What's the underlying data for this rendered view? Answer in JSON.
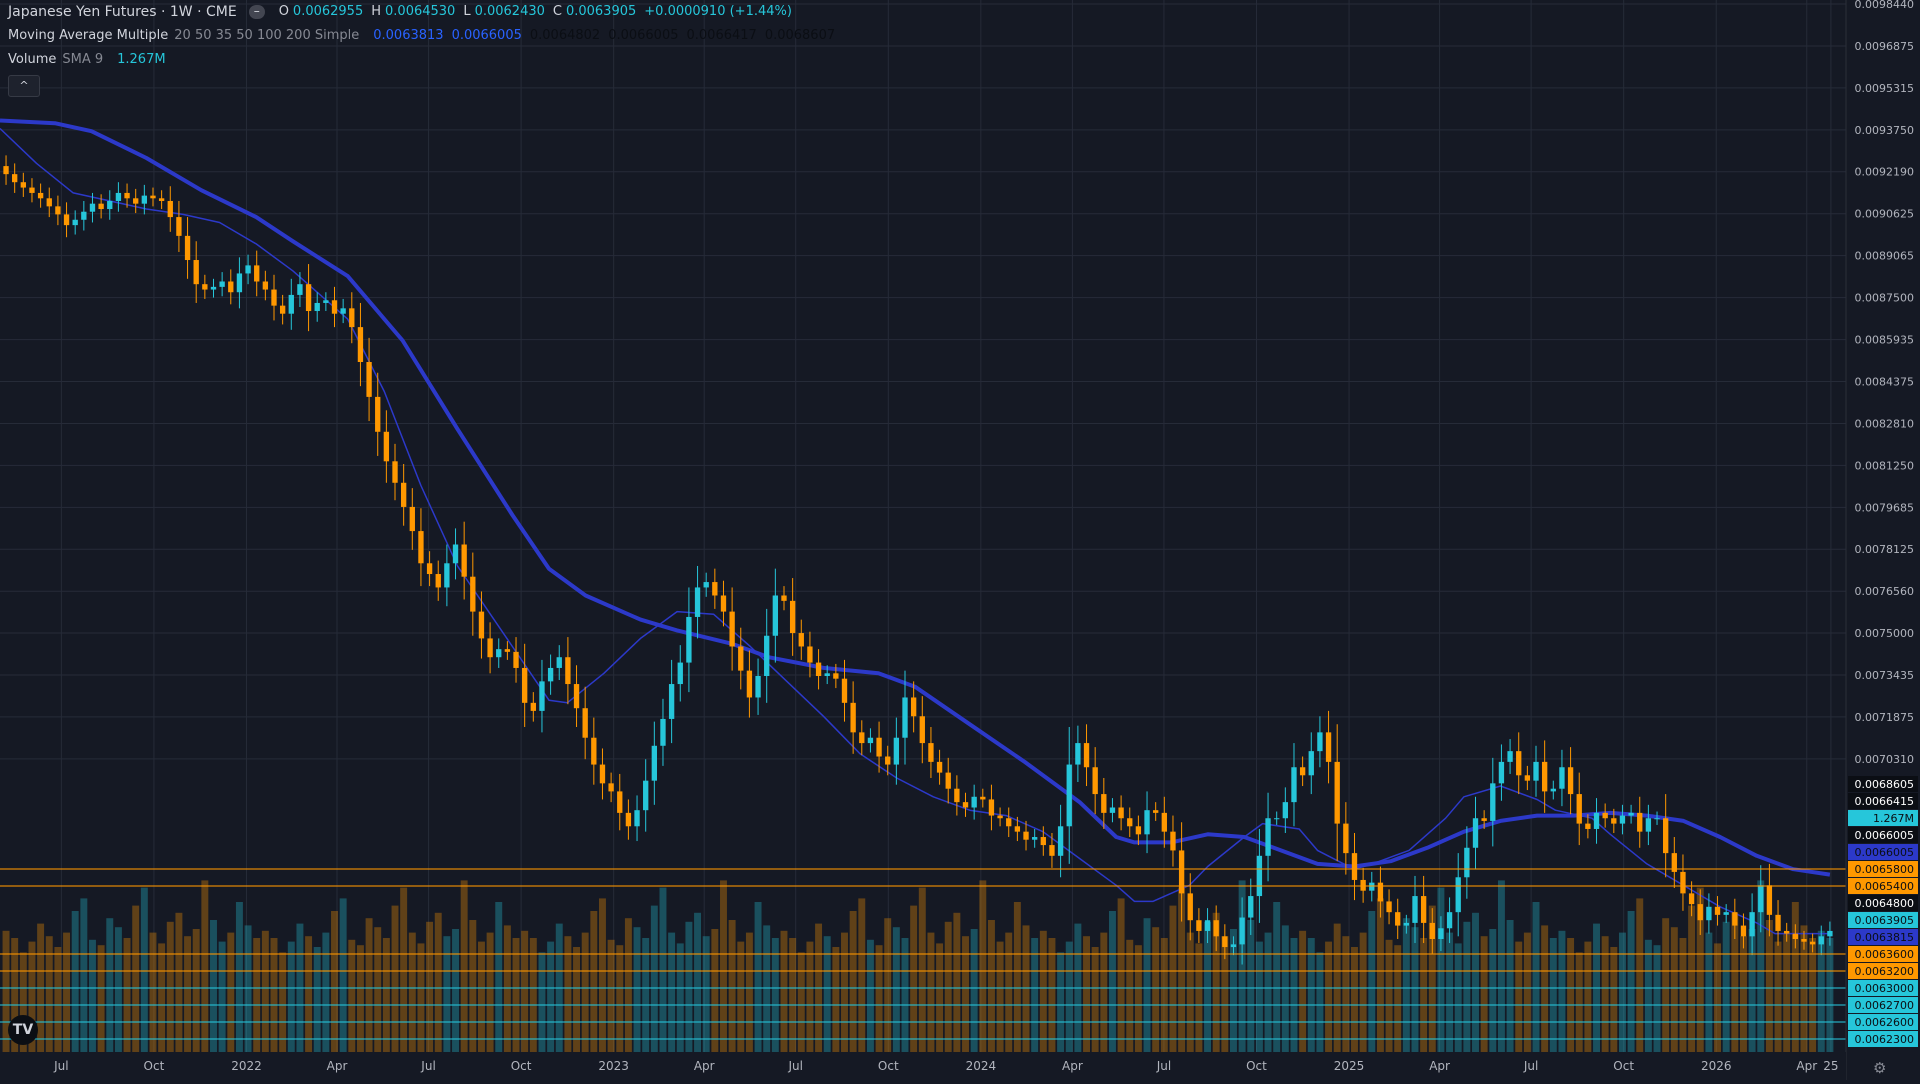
{
  "legend": {
    "symbol": "Japanese Yen Futures · 1W · CME",
    "o_label": "O",
    "o": "0.0062955",
    "h_label": "H",
    "h": "0.0064530",
    "l_label": "L",
    "l": "0.0062430",
    "c_label": "C",
    "c": "0.0063905",
    "change": "+0.0000910 (+1.44%)",
    "ma_name": "Moving Average Multiple",
    "ma_params": "20 50 35 50 100 200 Simple",
    "ma_values": [
      "0.0063813",
      "0.0066005",
      "0.0064802",
      "0.0066005",
      "0.0066417",
      "0.0068607"
    ],
    "ma_value_colors": [
      "#2962ff",
      "#2962ff",
      "#0b0e14",
      "#0b0e14",
      "#0b0e14",
      "#0b0e14"
    ],
    "vol_name": "Volume",
    "vol_params": "SMA 9",
    "vol_value": "1.267M",
    "collapse_icon": "^",
    "logo": "TV"
  },
  "chart_data": {
    "type": "candlestick",
    "instrument": "Japanese Yen Futures",
    "interval": "1W",
    "exchange": "CME",
    "colors": {
      "up": "#26c6da",
      "down": "#ff9800",
      "ma_fast": "#2c39c9",
      "ma_slow": "#2c39c9",
      "background": "#151924",
      "grid": "#262b38"
    },
    "ylim": [
      0.00623,
      0.009844
    ],
    "y_ticks": [
      "0.0098440",
      "0.0096875",
      "0.0095315",
      "0.0093750",
      "0.0092190",
      "0.0090625",
      "0.0089065",
      "0.0087500",
      "0.0085935",
      "0.0084375",
      "0.0082810",
      "0.0081250",
      "0.0079685",
      "0.0078125",
      "0.0076560",
      "0.0075000",
      "0.0073435",
      "0.0071875",
      "0.0070310"
    ],
    "x_ticks": [
      {
        "label": "Jul",
        "date": "2021-07-01"
      },
      {
        "label": "Oct",
        "date": "2021-10-01"
      },
      {
        "label": "2022",
        "date": "2022-01-01"
      },
      {
        "label": "Apr",
        "date": "2022-04-01"
      },
      {
        "label": "Jul",
        "date": "2022-07-01"
      },
      {
        "label": "Oct",
        "date": "2022-10-01"
      },
      {
        "label": "2023",
        "date": "2023-01-01"
      },
      {
        "label": "Apr",
        "date": "2023-04-01"
      },
      {
        "label": "Jul",
        "date": "2023-07-01"
      },
      {
        "label": "Oct",
        "date": "2023-10-01"
      },
      {
        "label": "2024",
        "date": "2024-01-01"
      },
      {
        "label": "Apr",
        "date": "2024-04-01"
      },
      {
        "label": "Jul",
        "date": "2024-07-01"
      },
      {
        "label": "Oct",
        "date": "2024-10-01"
      },
      {
        "label": "2025",
        "date": "2025-01-01"
      },
      {
        "label": "Apr",
        "date": "2025-04-01"
      },
      {
        "label": "Jul",
        "date": "2025-07-01"
      },
      {
        "label": "Oct",
        "date": "2025-10-01"
      },
      {
        "label": "2026",
        "date": "2026-01-01"
      },
      {
        "label": "Apr",
        "date": "2026-04-01"
      },
      {
        "label": "25",
        "date": "2026-04-25"
      }
    ],
    "price_levels": [
      {
        "label": "0.0068605",
        "bg": "#0b0e14",
        "line": false
      },
      {
        "label": "0.0066415",
        "bg": "#0b0e14",
        "line": false
      },
      {
        "label": "1.267M",
        "bg": "#26c6da",
        "line": false
      },
      {
        "label": "0.0066005",
        "bg": "#0b0e14",
        "line": false
      },
      {
        "label": "0.0066005",
        "bg": "#2c39c9",
        "line": false
      },
      {
        "label": "0.0065800",
        "bg": "#ff9800",
        "line": true
      },
      {
        "label": "0.0065400",
        "bg": "#ff9800",
        "line": true
      },
      {
        "label": "0.0064800",
        "bg": "#0b0e14",
        "line": false
      },
      {
        "label": "0.0063905",
        "bg": "#26c6da",
        "line": false
      },
      {
        "label": "0.0063815",
        "bg": "#2c39c9",
        "line": false
      },
      {
        "label": "0.0063600",
        "bg": "#ff9800",
        "line": true
      },
      {
        "label": "0.0063200",
        "bg": "#ff9800",
        "line": true
      },
      {
        "label": "0.0063000",
        "bg": "#26c6da",
        "line": true
      },
      {
        "label": "0.0062700",
        "bg": "#26c6da",
        "line": true
      },
      {
        "label": "0.0062600",
        "bg": "#26c6da",
        "line": true
      },
      {
        "label": "0.0062300",
        "bg": "#26c6da",
        "line": true
      }
    ],
    "close_series": {
      "x_start": "2021-05-07",
      "x_end": "2026-04-24",
      "closes": [
        0.00921,
        0.00918,
        0.00916,
        0.00914,
        0.00912,
        0.00909,
        0.00906,
        0.00902,
        0.00904,
        0.00907,
        0.0091,
        0.00908,
        0.00911,
        0.00914,
        0.00912,
        0.0091,
        0.00913,
        0.00912,
        0.00911,
        0.00905,
        0.00898,
        0.00889,
        0.0088,
        0.00878,
        0.00879,
        0.00881,
        0.00877,
        0.00884,
        0.00887,
        0.00881,
        0.00878,
        0.00872,
        0.00869,
        0.00876,
        0.0088,
        0.0087,
        0.00873,
        0.00874,
        0.00869,
        0.00871,
        0.00864,
        0.00851,
        0.00838,
        0.00825,
        0.00814,
        0.00806,
        0.00797,
        0.00788,
        0.00776,
        0.00772,
        0.00767,
        0.00776,
        0.00783,
        0.00771,
        0.00758,
        0.00748,
        0.00741,
        0.00744,
        0.00743,
        0.00737,
        0.00724,
        0.00721,
        0.00732,
        0.00737,
        0.00741,
        0.00731,
        0.00722,
        0.00711,
        0.00701,
        0.00694,
        0.00691,
        0.00683,
        0.00678,
        0.00684,
        0.00695,
        0.00708,
        0.00718,
        0.00731,
        0.00739,
        0.00756,
        0.00767,
        0.00769,
        0.00764,
        0.00758,
        0.00745,
        0.00736,
        0.00726,
        0.00734,
        0.00749,
        0.00764,
        0.00762,
        0.0075,
        0.00745,
        0.00739,
        0.00734,
        0.00735,
        0.00733,
        0.00724,
        0.00713,
        0.00709,
        0.00711,
        0.00704,
        0.00701,
        0.00711,
        0.00726,
        0.00719,
        0.00709,
        0.00702,
        0.00698,
        0.00692,
        0.00687,
        0.00685,
        0.00689,
        0.00688,
        0.00682,
        0.00681,
        0.00678,
        0.00676,
        0.00673,
        0.00674,
        0.00671,
        0.00667,
        0.00678,
        0.00701,
        0.00709,
        0.007,
        0.0069,
        0.00683,
        0.00685,
        0.00681,
        0.00678,
        0.00675,
        0.00684,
        0.00683,
        0.00676,
        0.00669,
        0.00653,
        0.00643,
        0.00639,
        0.00643,
        0.00637,
        0.00633,
        0.00634,
        0.00644,
        0.00652,
        0.00667,
        0.00681,
        0.00681,
        0.00687,
        0.007,
        0.00697,
        0.00706,
        0.00713,
        0.00702,
        0.00679,
        0.00668,
        0.00658,
        0.00654,
        0.00657,
        0.0065,
        0.00646,
        0.00641,
        0.00642,
        0.00652,
        0.00642,
        0.00636,
        0.0064,
        0.00646,
        0.00659,
        0.0067,
        0.00681,
        0.0068,
        0.00694,
        0.00702,
        0.00706,
        0.00697,
        0.00695,
        0.00702,
        0.00691,
        0.00692,
        0.007,
        0.0069,
        0.00679,
        0.00677,
        0.00683,
        0.00681,
        0.00679,
        0.00682,
        0.00683,
        0.00676,
        0.00681,
        0.00681,
        0.00668,
        0.00661,
        0.00653,
        0.00649,
        0.00643,
        0.00648,
        0.00645,
        0.00646,
        0.00641,
        0.00637,
        0.00646,
        0.00656,
        0.00645,
        0.00639,
        0.00638,
        0.00636,
        0.00635,
        0.00634,
        0.00637,
        0.00639
      ]
    },
    "ma_fast": [
      [
        0.0,
        0.00938
      ],
      [
        0.02,
        0.00925
      ],
      [
        0.04,
        0.00914
      ],
      [
        0.08,
        0.00908
      ],
      [
        0.1,
        0.00906
      ],
      [
        0.12,
        0.00903
      ],
      [
        0.14,
        0.00895
      ],
      [
        0.16,
        0.00885
      ],
      [
        0.19,
        0.00867
      ],
      [
        0.21,
        0.0084
      ],
      [
        0.23,
        0.00805
      ],
      [
        0.25,
        0.00775
      ],
      [
        0.28,
        0.00745
      ],
      [
        0.3,
        0.00725
      ],
      [
        0.31,
        0.00724
      ],
      [
        0.33,
        0.00735
      ],
      [
        0.35,
        0.00748
      ],
      [
        0.37,
        0.00758
      ],
      [
        0.39,
        0.00757
      ],
      [
        0.41,
        0.00745
      ],
      [
        0.43,
        0.00732
      ],
      [
        0.45,
        0.00719
      ],
      [
        0.47,
        0.00705
      ],
      [
        0.49,
        0.00696
      ],
      [
        0.51,
        0.00689
      ],
      [
        0.53,
        0.00684
      ],
      [
        0.55,
        0.00682
      ],
      [
        0.57,
        0.00676
      ],
      [
        0.59,
        0.00666
      ],
      [
        0.61,
        0.00656
      ],
      [
        0.62,
        0.0065
      ],
      [
        0.63,
        0.0065
      ],
      [
        0.65,
        0.00656
      ],
      [
        0.66,
        0.00663
      ],
      [
        0.68,
        0.00674
      ],
      [
        0.69,
        0.00679
      ],
      [
        0.71,
        0.00677
      ],
      [
        0.72,
        0.00669
      ],
      [
        0.74,
        0.00662
      ],
      [
        0.75,
        0.00664
      ],
      [
        0.77,
        0.00669
      ],
      [
        0.79,
        0.00681
      ],
      [
        0.8,
        0.00689
      ],
      [
        0.82,
        0.00693
      ],
      [
        0.84,
        0.00688
      ],
      [
        0.85,
        0.00684
      ],
      [
        0.87,
        0.00681
      ],
      [
        0.88,
        0.00675
      ],
      [
        0.9,
        0.00664
      ],
      [
        0.92,
        0.00656
      ],
      [
        0.94,
        0.00648
      ],
      [
        0.96,
        0.00642
      ],
      [
        0.97,
        0.00638
      ],
      [
        1.0,
        0.00638
      ]
    ],
    "ma_slow": [
      [
        0.0,
        0.00941
      ],
      [
        0.03,
        0.0094
      ],
      [
        0.05,
        0.00937
      ],
      [
        0.08,
        0.00927
      ],
      [
        0.11,
        0.00915
      ],
      [
        0.14,
        0.00905
      ],
      [
        0.16,
        0.00896
      ],
      [
        0.19,
        0.00883
      ],
      [
        0.22,
        0.00859
      ],
      [
        0.25,
        0.00826
      ],
      [
        0.28,
        0.00794
      ],
      [
        0.3,
        0.00774
      ],
      [
        0.32,
        0.00764
      ],
      [
        0.35,
        0.00755
      ],
      [
        0.37,
        0.00751
      ],
      [
        0.4,
        0.00746
      ],
      [
        0.42,
        0.00741
      ],
      [
        0.45,
        0.00737
      ],
      [
        0.48,
        0.00735
      ],
      [
        0.5,
        0.0073
      ],
      [
        0.53,
        0.00716
      ],
      [
        0.56,
        0.00702
      ],
      [
        0.59,
        0.00687
      ],
      [
        0.61,
        0.00674
      ],
      [
        0.62,
        0.00672
      ],
      [
        0.64,
        0.00672
      ],
      [
        0.66,
        0.00675
      ],
      [
        0.68,
        0.00674
      ],
      [
        0.7,
        0.00669
      ],
      [
        0.72,
        0.00664
      ],
      [
        0.74,
        0.00663
      ],
      [
        0.76,
        0.00665
      ],
      [
        0.78,
        0.0067
      ],
      [
        0.8,
        0.00676
      ],
      [
        0.82,
        0.0068
      ],
      [
        0.84,
        0.00682
      ],
      [
        0.86,
        0.00682
      ],
      [
        0.88,
        0.00683
      ],
      [
        0.9,
        0.00682
      ],
      [
        0.92,
        0.0068
      ],
      [
        0.94,
        0.00674
      ],
      [
        0.96,
        0.00667
      ],
      [
        0.98,
        0.00662
      ],
      [
        1.0,
        0.0066
      ]
    ],
    "volume_pattern": [
      0.34,
      0.3,
      0.22,
      0.28,
      0.38,
      0.31,
      0.25,
      0.33,
      0.45,
      0.52,
      0.29,
      0.26,
      0.41,
      0.36,
      0.3,
      0.48,
      0.58,
      0.33,
      0.27,
      0.39,
      0.44,
      0.31,
      0.35,
      0.62,
      0.4,
      0.28,
      0.33,
      0.5,
      0.37,
      0.3
    ]
  }
}
